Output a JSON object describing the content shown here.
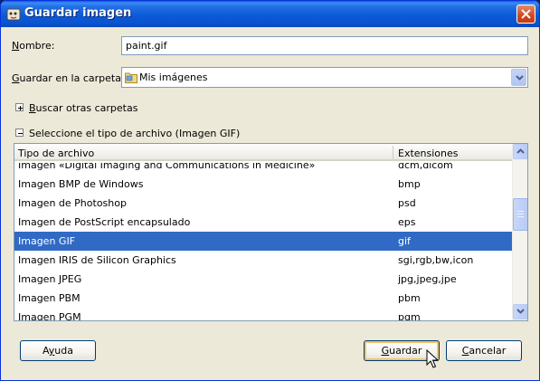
{
  "window": {
    "title": "Guardar imagen"
  },
  "form": {
    "name_label": "Nombre:",
    "name_value": "paint.gif",
    "folder_label": "Guardar en la carpeta:",
    "folder_value": "Mis imágenes",
    "browse_label": "Buscar otras carpetas",
    "filetype_label": "Seleccione el tipo de archivo (Imagen GIF)"
  },
  "table": {
    "columns": [
      "Tipo de archivo",
      "Extensiones"
    ],
    "rows": [
      {
        "type": "Imagen «Digital Imaging and Communications in Medicine»",
        "ext": "dcm,dicom"
      },
      {
        "type": "Imagen BMP de Windows",
        "ext": "bmp"
      },
      {
        "type": "Imagen de Photoshop",
        "ext": "psd"
      },
      {
        "type": "Imagen de PostScript encapsulado",
        "ext": "eps"
      },
      {
        "type": "Imagen GIF",
        "ext": "gif",
        "selected": true
      },
      {
        "type": "Imagen IRIS de Silicon Graphics",
        "ext": "sgi,rgb,bw,icon"
      },
      {
        "type": "Imagen JPEG",
        "ext": "jpg,jpeg,jpe"
      },
      {
        "type": "Imagen PBM",
        "ext": "pbm"
      },
      {
        "type": "Imagen PGM",
        "ext": "pgm"
      }
    ]
  },
  "buttons": {
    "help": "Ayuda",
    "save": "Guardar",
    "cancel": "Cancelar"
  },
  "colors": {
    "selection": "#316ac5",
    "titlebar": "#0a53cf"
  }
}
